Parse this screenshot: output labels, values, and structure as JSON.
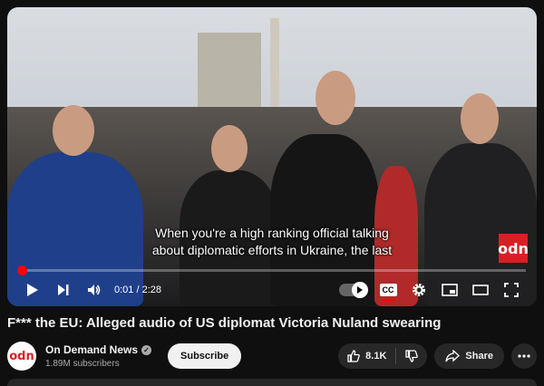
{
  "video": {
    "caption_line1": "When you're a high ranking official talking",
    "caption_line2": "about diplomatic efforts in Ukraine, the last",
    "watermark": "odn",
    "progress": 0.007,
    "time_current": "0:01",
    "time_total": "2:28",
    "time_sep": " / ",
    "autoplay_on": true,
    "captions_on": true
  },
  "icons": {
    "play": "play-icon",
    "next": "next-icon",
    "volume": "volume-icon",
    "autoplay": "autoplay-toggle-icon",
    "cc": "captions-icon",
    "settings": "gear-icon",
    "miniplayer": "miniplayer-icon",
    "theater": "theater-icon",
    "fullscreen": "fullscreen-icon"
  },
  "cc_label": "CC",
  "title": "F*** the EU: Alleged audio of US diplomat Victoria Nuland swearing",
  "channel": {
    "avatar_text": "odn",
    "name": "On Demand News",
    "subscribers": "1.89M subscribers",
    "subscribe_label": "Subscribe"
  },
  "actions": {
    "likes": "8.1K",
    "share_label": "Share"
  },
  "colors": {
    "accent": "#ff0000",
    "brand": "#d91f26",
    "background": "#0f0f0f"
  }
}
